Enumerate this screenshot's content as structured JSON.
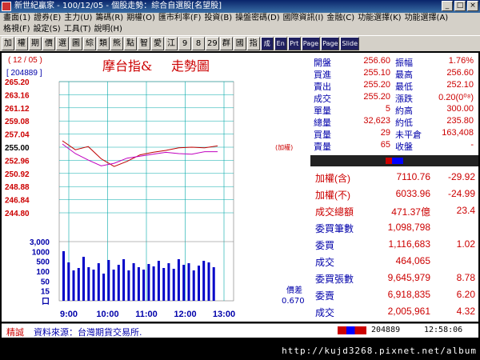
{
  "window": {
    "title": "新世紀贏家 - 100/12/05 - 個股走勢：綜合自選股[名望股]",
    "buttons": [
      "_",
      "□",
      "×"
    ]
  },
  "menu": {
    "row1": [
      "畫面(1)",
      "證券(E)",
      "主力(U)",
      "籌碼(R)",
      "期權(O)",
      "匯市利率(F)",
      "投資(B)",
      "操盤密碼(D)",
      "國際資訊(I)",
      "金融(C)",
      "功能選擇(K)",
      "功能選擇(A)"
    ],
    "row2": [
      "格視(F)",
      "設定(S)",
      "工具(T)",
      "說明(H)"
    ]
  },
  "toolbar": [
    "加",
    "權",
    "期",
    "價",
    "選",
    "圖",
    "綜",
    "類",
    "熊",
    "點",
    "智",
    "愛",
    "江",
    "9",
    "8",
    "29",
    "群",
    "國",
    "指",
    "成",
    "En",
    "Prt",
    "Page",
    "Page",
    "Slide"
  ],
  "chart": {
    "date": "( 12 / 05 )",
    "code": "[ 204889 ]",
    "title_a": "摩台指&",
    "title_b": "走勢圖",
    "ref_label": "(加權)",
    "price_ticks": [
      "265.20",
      "263.16",
      "261.12",
      "259.08",
      "257.04",
      "255.00",
      "252.96",
      "250.92",
      "248.88",
      "246.84",
      "244.80"
    ],
    "vol_ticks": [
      "3,000",
      "1000",
      "500",
      "100",
      "50",
      "15",
      "口"
    ],
    "time_ticks": [
      "9:00",
      "10:00",
      "11:00",
      "12:00",
      "13:00"
    ],
    "spread_label": "價差",
    "spread_value": "0.670"
  },
  "chart_data": {
    "type": "line",
    "title": "摩台指& 走勢圖",
    "ylim": [
      244.8,
      265.2
    ],
    "x": [
      "9:00",
      "10:00",
      "11:00",
      "12:00",
      "13:00"
    ],
    "series": [
      {
        "name": "",
        "values": [
          256.0,
          254.6,
          255.1,
          253.2,
          252.0,
          252.8,
          253.8,
          254.2,
          254.5,
          254.9,
          255.0,
          254.9,
          255.2
        ]
      },
      {
        "name": "加權",
        "values": [
          255.5,
          254.0,
          253.0,
          252.1,
          252.5,
          253.3,
          253.6,
          253.9,
          254.2,
          254.0,
          253.9,
          254.3,
          254.3
        ]
      }
    ],
    "volume": [
      620,
      480,
      380,
      410,
      550,
      420,
      390,
      470,
      340,
      510,
      390,
      450,
      520,
      380,
      470,
      420,
      390,
      460,
      430,
      500,
      410,
      470,
      400,
      520,
      450,
      470,
      380,
      440,
      500,
      480,
      420
    ]
  },
  "quote": {
    "rows": [
      {
        "l1": "開盤",
        "v1": "256.60",
        "l2": "振幅",
        "v2": "1.76%"
      },
      {
        "l1": "買進",
        "v1": "255.10",
        "l2": "最高",
        "v2": "256.60"
      },
      {
        "l1": "賣出",
        "v1": "255.20",
        "l2": "最低",
        "v2": "252.10"
      },
      {
        "l1": "成交",
        "v1": "255.20",
        "l2": "漲跌",
        "v2": "0.20(0⁰⁸)"
      },
      {
        "l1": "單量",
        "v1": "5",
        "l2": "約高",
        "v2": "300.00"
      },
      {
        "l1": "總量",
        "v1": "32,623",
        "l2": "約低",
        "v2": "235.80"
      },
      {
        "l1": "買量",
        "v1": "29",
        "l2": "未平倉",
        "v2": "163,408"
      },
      {
        "l1": "賣量",
        "v1": "65",
        "l2": "收盤",
        "v2": "-"
      }
    ],
    "stats": [
      {
        "label": "加權(含)",
        "value": "7110.76",
        "change": "-29.92"
      },
      {
        "label": "加權(不)",
        "value": "6033.96",
        "change": "-24.99"
      },
      {
        "label": "成交總額",
        "value": "471.37億",
        "change": "23.4"
      },
      {
        "label": "委買筆數",
        "value": "1,098,798",
        "change": ""
      },
      {
        "label": "委買",
        "value": "1,116,683",
        "change": "1.02"
      },
      {
        "label": "成交",
        "value": "464,065",
        "change": ""
      },
      {
        "label": "委買張數",
        "value": "9,645,979",
        "change": "8.78"
      },
      {
        "label": "委賣",
        "value": "6,918,835",
        "change": "6.20"
      },
      {
        "label": "成交",
        "value": "2,005,961",
        "change": "4.32"
      }
    ]
  },
  "status": {
    "label": "精誠",
    "source": "資料來源：台灣期貨交易所.",
    "code": "204889",
    "time": "12:58:06"
  },
  "footer": {
    "url": "http://kujd3268.pixnet.net/album"
  }
}
